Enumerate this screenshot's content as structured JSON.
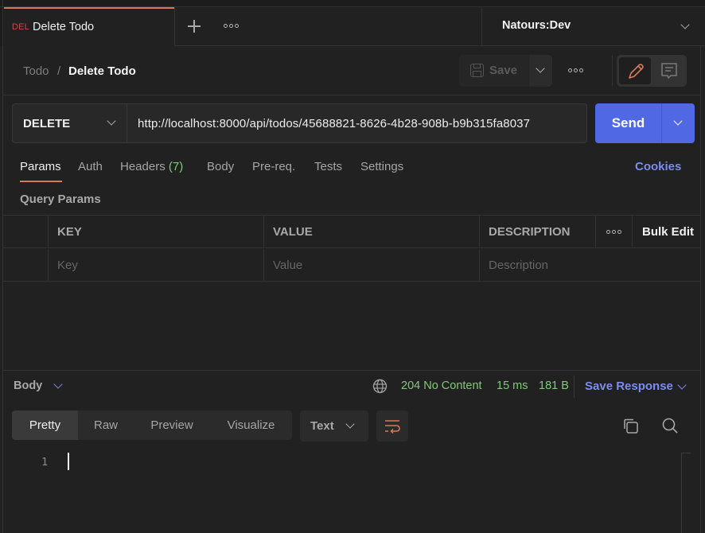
{
  "tabs": [
    {
      "method": "DEL",
      "title": "Delete Todo",
      "active": true
    }
  ],
  "tabbar": {
    "new_tab_icon": "plus-icon",
    "more_icon": "ellipsis-icon"
  },
  "environment": {
    "selected": "Natours:Dev"
  },
  "breadcrumb": {
    "parent": "Todo",
    "separator": "/",
    "current": "Delete Todo"
  },
  "header_actions": {
    "save_label": "Save",
    "save_icon": "floppy-disk-icon",
    "more_icon": "ellipsis-icon",
    "edit_icon": "pencil-icon",
    "comment_icon": "comment-icon"
  },
  "request": {
    "method": "DELETE",
    "url": "http://localhost:8000/api/todos/45688821-8626-4b28-908b-b9b315fa8037",
    "send_label": "Send"
  },
  "request_tabs": [
    {
      "label": "Params",
      "active": true
    },
    {
      "label": "Auth"
    },
    {
      "label": "Headers",
      "count": "(7)"
    },
    {
      "label": "Body"
    },
    {
      "label": "Pre-req."
    },
    {
      "label": "Tests"
    },
    {
      "label": "Settings"
    }
  ],
  "cookies_label": "Cookies",
  "query_params": {
    "title": "Query Params",
    "columns": [
      "KEY",
      "VALUE",
      "DESCRIPTION"
    ],
    "bulk_edit": "Bulk Edit",
    "placeholders": {
      "key": "Key",
      "value": "Value",
      "description": "Description"
    }
  },
  "response": {
    "section_label": "Body",
    "status": "204 No Content",
    "time": "15 ms",
    "size": "181 B",
    "save_response": "Save Response",
    "views": [
      "Pretty",
      "Raw",
      "Preview",
      "Visualize"
    ],
    "active_view": "Pretty",
    "format": "Text",
    "line_numbers": [
      "1"
    ],
    "colors": {
      "status_green": "#82c879",
      "link_blue": "#7b8cf0",
      "accent_orange": "#d67a57",
      "send_blue": "#5068e3",
      "delete_red": "#c94a4a"
    }
  }
}
